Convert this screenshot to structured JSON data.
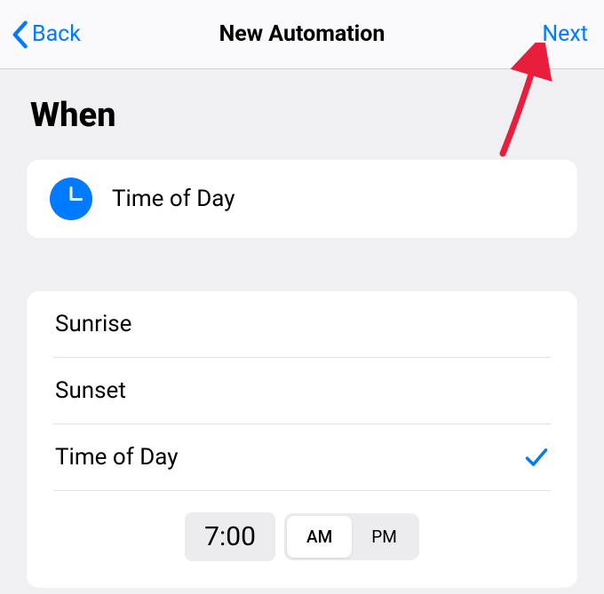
{
  "nav": {
    "back_label": "Back",
    "title": "New Automation",
    "next_label": "Next"
  },
  "section_header": "When",
  "summary": {
    "label": "Time of Day"
  },
  "options": [
    {
      "label": "Sunrise",
      "selected": false
    },
    {
      "label": "Sunset",
      "selected": false
    },
    {
      "label": "Time of Day",
      "selected": true
    }
  ],
  "time_picker": {
    "time": "7:00",
    "am_label": "AM",
    "pm_label": "PM",
    "selected": "AM"
  },
  "colors": {
    "accent": "#007aff",
    "annotation_arrow": "#e91e3c"
  }
}
